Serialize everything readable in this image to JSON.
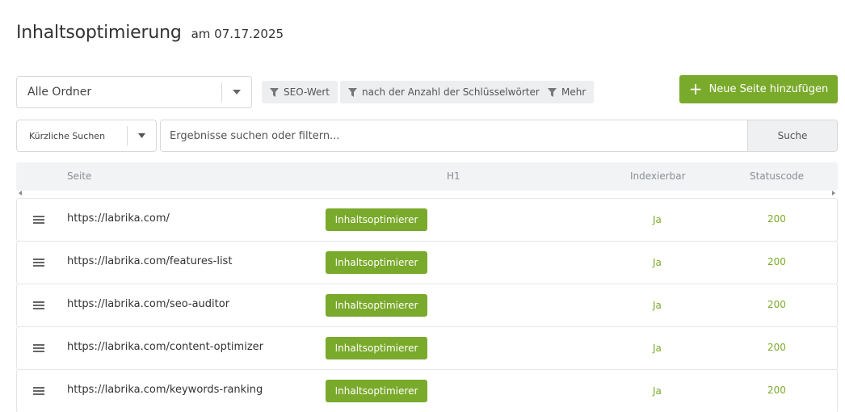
{
  "header": {
    "title": "Inhaltsoptimierung",
    "date": "am 07.17.2025"
  },
  "folder_select": {
    "value": "Alle Ordner"
  },
  "filters": [
    {
      "label": "SEO-Wert",
      "icon": "filter-icon"
    },
    {
      "label": "nach der Anzahl der Schlüsselwörter",
      "icon": "filter-icon"
    },
    {
      "label": "Mehr",
      "icon": "filter-icon"
    }
  ],
  "add_button": {
    "label": "Neue Seite hinzufügen",
    "icon": "plus-icon"
  },
  "recent_select": {
    "value": "Kürzliche Suchen"
  },
  "search": {
    "placeholder": "Ergebnisse suchen oder filtern...",
    "button_label": "Suche"
  },
  "table": {
    "columns": [
      "Seite",
      "H1",
      "Indexierbar",
      "Statuscode"
    ],
    "rows": [
      {
        "url": "https://labrika.com/",
        "h1": "Inhaltsoptimierer",
        "indexable": "Ja",
        "status": "200"
      },
      {
        "url": "https://labrika.com/features-list",
        "h1": "Inhaltsoptimierer",
        "indexable": "Ja",
        "status": "200"
      },
      {
        "url": "https://labrika.com/seo-auditor",
        "h1": "Inhaltsoptimierer",
        "indexable": "Ja",
        "status": "200"
      },
      {
        "url": "https://labrika.com/content-optimizer",
        "h1": "Inhaltsoptimierer",
        "indexable": "Ja",
        "status": "200"
      },
      {
        "url": "https://labrika.com/keywords-ranking",
        "h1": "Inhaltsoptimierer",
        "indexable": "Ja",
        "status": "200"
      }
    ]
  },
  "colors": {
    "accent": "#7aaa2b",
    "chip_bg": "#eceeef",
    "header_bg": "#f2f3f4",
    "border": "#d6d9dc"
  }
}
